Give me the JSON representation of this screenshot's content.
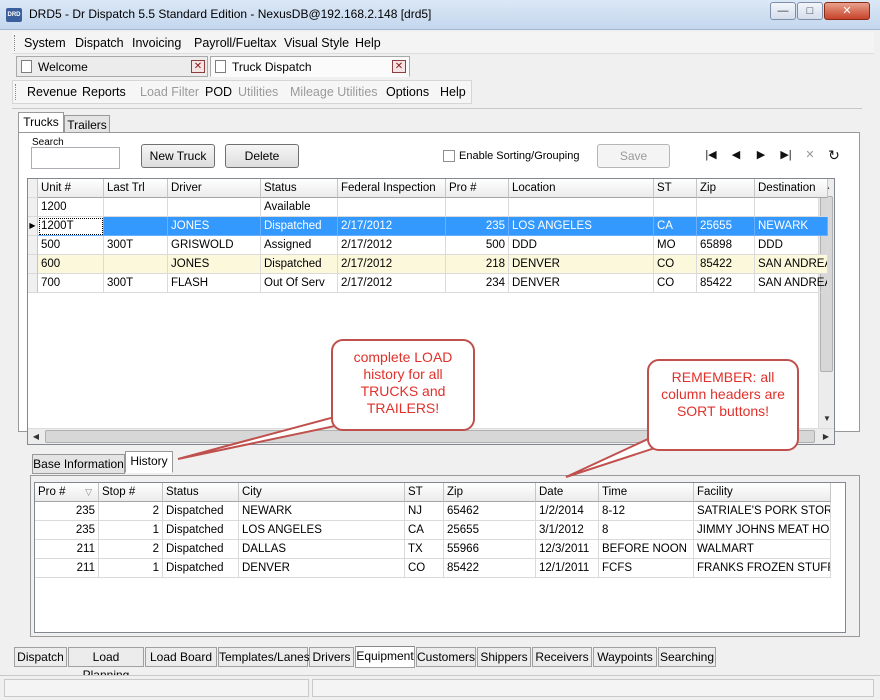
{
  "window": {
    "title": "DRD5 - Dr Dispatch 5.5 Standard Edition - NexusDB@192.168.2.148 [drd5]",
    "app_icon_text": "DRD"
  },
  "menu": [
    "System",
    "Dispatch",
    "Invoicing",
    "Payroll/Fueltax",
    "Visual Style",
    "Help"
  ],
  "doc_tabs": [
    {
      "label": "Welcome"
    },
    {
      "label": "Truck Dispatch"
    }
  ],
  "toolbar": [
    {
      "label": "Revenue",
      "enabled": true
    },
    {
      "label": "Reports",
      "enabled": true
    },
    {
      "label": "Load Filter",
      "enabled": false
    },
    {
      "label": "POD",
      "enabled": true
    },
    {
      "label": "Utilities",
      "enabled": false
    },
    {
      "label": "Mileage Utilities",
      "enabled": false
    },
    {
      "label": "Options",
      "enabled": true
    },
    {
      "label": "Help",
      "enabled": true
    }
  ],
  "equipment_tabs": [
    "Trucks",
    "Trailers"
  ],
  "search": {
    "label": "Search",
    "value": ""
  },
  "buttons": {
    "new_truck": "New Truck",
    "delete": "Delete",
    "save": "Save"
  },
  "enable_sorting": {
    "label": "Enable Sorting/Grouping",
    "checked": false
  },
  "trucks_grid": {
    "columns": [
      "Unit #",
      "Last Trl",
      "Driver",
      "Status",
      "Federal Inspection",
      "Pro #",
      "Location",
      "ST",
      "Zip",
      "Destination"
    ],
    "rows": [
      [
        "1200",
        "",
        "",
        "Available",
        "",
        "",
        "",
        "",
        "",
        ""
      ],
      [
        "1200T",
        "",
        "JONES",
        "Dispatched",
        "2/17/2012",
        "235",
        "LOS ANGELES",
        "CA",
        "25655",
        "NEWARK"
      ],
      [
        "500",
        "300T",
        "GRISWOLD",
        "Assigned",
        "2/17/2012",
        "500",
        "DDD",
        "MO",
        "65898",
        "DDD"
      ],
      [
        "600",
        "",
        "JONES",
        "Dispatched",
        "2/17/2012",
        "218",
        "DENVER",
        "CO",
        "85422",
        "SAN ANDREA"
      ],
      [
        "700",
        "300T",
        "FLASH",
        "Out Of Serv",
        "2/17/2012",
        "234",
        "DENVER",
        "CO",
        "85422",
        "SAN ANDREA"
      ]
    ],
    "selected_row": 1
  },
  "detail_tabs": [
    "Base Information",
    "History"
  ],
  "history_grid": {
    "columns": [
      "Pro #",
      "Stop #",
      "Status",
      "City",
      "ST",
      "Zip",
      "Date",
      "Time",
      "Facility"
    ],
    "rows": [
      [
        "235",
        "2",
        "Dispatched",
        "NEWARK",
        "NJ",
        "65462",
        "1/2/2014",
        "8-12",
        "SATRIALE'S PORK STORE"
      ],
      [
        "235",
        "1",
        "Dispatched",
        "LOS ANGELES",
        "CA",
        "25655",
        "3/1/2012",
        "8",
        "JIMMY JOHNS MEAT HOUS"
      ],
      [
        "211",
        "2",
        "Dispatched",
        "DALLAS",
        "TX",
        "55966",
        "12/3/2011",
        "BEFORE NOON",
        "WALMART"
      ],
      [
        "211",
        "1",
        "Dispatched",
        "DENVER",
        "CO",
        "85422",
        "12/1/2011",
        "FCFS",
        "FRANKS FROZEN STUFF"
      ]
    ]
  },
  "callouts": {
    "load_history": "complete LOAD history for all TRUCKS and TRAILERS!",
    "sort_buttons": "REMEMBER: all column headers are SORT buttons!"
  },
  "bottom_tabs": [
    "Dispatch",
    "Load Planning",
    "Load Board",
    "Templates/Lanes",
    "Drivers",
    "Equipment",
    "Customers",
    "Shippers",
    "Receivers",
    "Waypoints",
    "Searching"
  ],
  "active_bottom_tab": "Equipment",
  "colors": {
    "selection": "#3399ff",
    "callout": "#e0312b",
    "alt_row": "#fbf8dc"
  }
}
